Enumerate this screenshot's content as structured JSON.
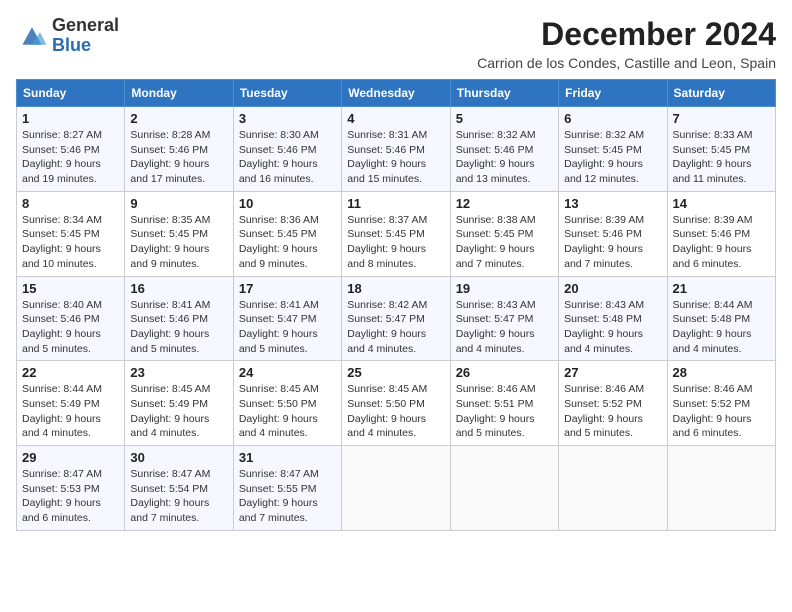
{
  "logo": {
    "general": "General",
    "blue": "Blue"
  },
  "title": "December 2024",
  "subtitle": "Carrion de los Condes, Castille and Leon, Spain",
  "headers": [
    "Sunday",
    "Monday",
    "Tuesday",
    "Wednesday",
    "Thursday",
    "Friday",
    "Saturday"
  ],
  "weeks": [
    [
      {
        "day": "1",
        "sunrise": "8:27 AM",
        "sunset": "5:46 PM",
        "daylight": "9 hours and 19 minutes."
      },
      {
        "day": "2",
        "sunrise": "8:28 AM",
        "sunset": "5:46 PM",
        "daylight": "9 hours and 17 minutes."
      },
      {
        "day": "3",
        "sunrise": "8:30 AM",
        "sunset": "5:46 PM",
        "daylight": "9 hours and 16 minutes."
      },
      {
        "day": "4",
        "sunrise": "8:31 AM",
        "sunset": "5:46 PM",
        "daylight": "9 hours and 15 minutes."
      },
      {
        "day": "5",
        "sunrise": "8:32 AM",
        "sunset": "5:46 PM",
        "daylight": "9 hours and 13 minutes."
      },
      {
        "day": "6",
        "sunrise": "8:32 AM",
        "sunset": "5:45 PM",
        "daylight": "9 hours and 12 minutes."
      },
      {
        "day": "7",
        "sunrise": "8:33 AM",
        "sunset": "5:45 PM",
        "daylight": "9 hours and 11 minutes."
      }
    ],
    [
      {
        "day": "8",
        "sunrise": "8:34 AM",
        "sunset": "5:45 PM",
        "daylight": "9 hours and 10 minutes."
      },
      {
        "day": "9",
        "sunrise": "8:35 AM",
        "sunset": "5:45 PM",
        "daylight": "9 hours and 9 minutes."
      },
      {
        "day": "10",
        "sunrise": "8:36 AM",
        "sunset": "5:45 PM",
        "daylight": "9 hours and 9 minutes."
      },
      {
        "day": "11",
        "sunrise": "8:37 AM",
        "sunset": "5:45 PM",
        "daylight": "9 hours and 8 minutes."
      },
      {
        "day": "12",
        "sunrise": "8:38 AM",
        "sunset": "5:45 PM",
        "daylight": "9 hours and 7 minutes."
      },
      {
        "day": "13",
        "sunrise": "8:39 AM",
        "sunset": "5:46 PM",
        "daylight": "9 hours and 7 minutes."
      },
      {
        "day": "14",
        "sunrise": "8:39 AM",
        "sunset": "5:46 PM",
        "daylight": "9 hours and 6 minutes."
      }
    ],
    [
      {
        "day": "15",
        "sunrise": "8:40 AM",
        "sunset": "5:46 PM",
        "daylight": "9 hours and 5 minutes."
      },
      {
        "day": "16",
        "sunrise": "8:41 AM",
        "sunset": "5:46 PM",
        "daylight": "9 hours and 5 minutes."
      },
      {
        "day": "17",
        "sunrise": "8:41 AM",
        "sunset": "5:47 PM",
        "daylight": "9 hours and 5 minutes."
      },
      {
        "day": "18",
        "sunrise": "8:42 AM",
        "sunset": "5:47 PM",
        "daylight": "9 hours and 4 minutes."
      },
      {
        "day": "19",
        "sunrise": "8:43 AM",
        "sunset": "5:47 PM",
        "daylight": "9 hours and 4 minutes."
      },
      {
        "day": "20",
        "sunrise": "8:43 AM",
        "sunset": "5:48 PM",
        "daylight": "9 hours and 4 minutes."
      },
      {
        "day": "21",
        "sunrise": "8:44 AM",
        "sunset": "5:48 PM",
        "daylight": "9 hours and 4 minutes."
      }
    ],
    [
      {
        "day": "22",
        "sunrise": "8:44 AM",
        "sunset": "5:49 PM",
        "daylight": "9 hours and 4 minutes."
      },
      {
        "day": "23",
        "sunrise": "8:45 AM",
        "sunset": "5:49 PM",
        "daylight": "9 hours and 4 minutes."
      },
      {
        "day": "24",
        "sunrise": "8:45 AM",
        "sunset": "5:50 PM",
        "daylight": "9 hours and 4 minutes."
      },
      {
        "day": "25",
        "sunrise": "8:45 AM",
        "sunset": "5:50 PM",
        "daylight": "9 hours and 4 minutes."
      },
      {
        "day": "26",
        "sunrise": "8:46 AM",
        "sunset": "5:51 PM",
        "daylight": "9 hours and 5 minutes."
      },
      {
        "day": "27",
        "sunrise": "8:46 AM",
        "sunset": "5:52 PM",
        "daylight": "9 hours and 5 minutes."
      },
      {
        "day": "28",
        "sunrise": "8:46 AM",
        "sunset": "5:52 PM",
        "daylight": "9 hours and 6 minutes."
      }
    ],
    [
      {
        "day": "29",
        "sunrise": "8:47 AM",
        "sunset": "5:53 PM",
        "daylight": "9 hours and 6 minutes."
      },
      {
        "day": "30",
        "sunrise": "8:47 AM",
        "sunset": "5:54 PM",
        "daylight": "9 hours and 7 minutes."
      },
      {
        "day": "31",
        "sunrise": "8:47 AM",
        "sunset": "5:55 PM",
        "daylight": "9 hours and 7 minutes."
      },
      null,
      null,
      null,
      null
    ]
  ]
}
